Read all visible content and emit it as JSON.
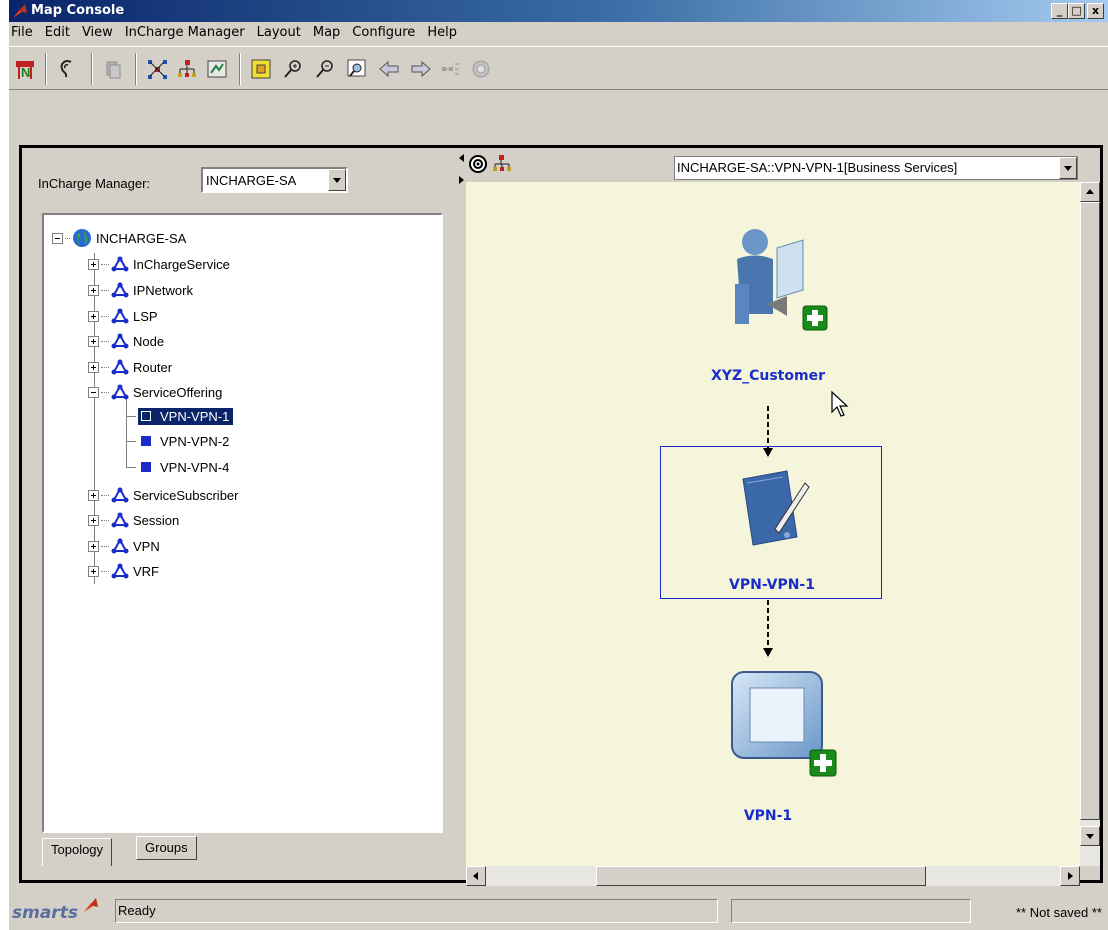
{
  "window": {
    "title": "Map Console",
    "min": "_",
    "max": "□",
    "close": "x"
  },
  "menu": [
    "File",
    "Edit",
    "View",
    "InCharge Manager",
    "Layout",
    "Map",
    "Configure",
    "Help"
  ],
  "left": {
    "manager_label": "InCharge Manager:",
    "manager_value": "INCHARGE-SA",
    "tree": {
      "root": "INCHARGE-SA",
      "classes": [
        "InChargeService",
        "IPNetwork",
        "LSP",
        "Node",
        "Router",
        "ServiceOffering"
      ],
      "service_offerings": [
        "VPN-VPN-1",
        "VPN-VPN-2",
        "VPN-VPN-4"
      ],
      "selected": "VPN-VPN-1",
      "more_classes": [
        "ServiceSubscriber",
        "Session",
        "VPN",
        "VRF"
      ]
    },
    "tabs": [
      "Topology",
      "Groups"
    ],
    "active_tab": "Topology"
  },
  "map": {
    "selector_value": "INCHARGE-SA::VPN-VPN-1[Business Services]",
    "nodes": [
      {
        "label": "XYZ_Customer",
        "icon": "customer-icon",
        "expandable": true
      },
      {
        "label": "VPN-VPN-1",
        "icon": "service-offering-icon",
        "selected": true
      },
      {
        "label": "VPN-1",
        "icon": "vpn-icon",
        "expandable": true
      }
    ],
    "background": "#f5f5dc",
    "label_color": "#1a2dc8"
  },
  "status": {
    "logo": "smarts",
    "message": "Ready",
    "save_state": "** Not saved **"
  }
}
